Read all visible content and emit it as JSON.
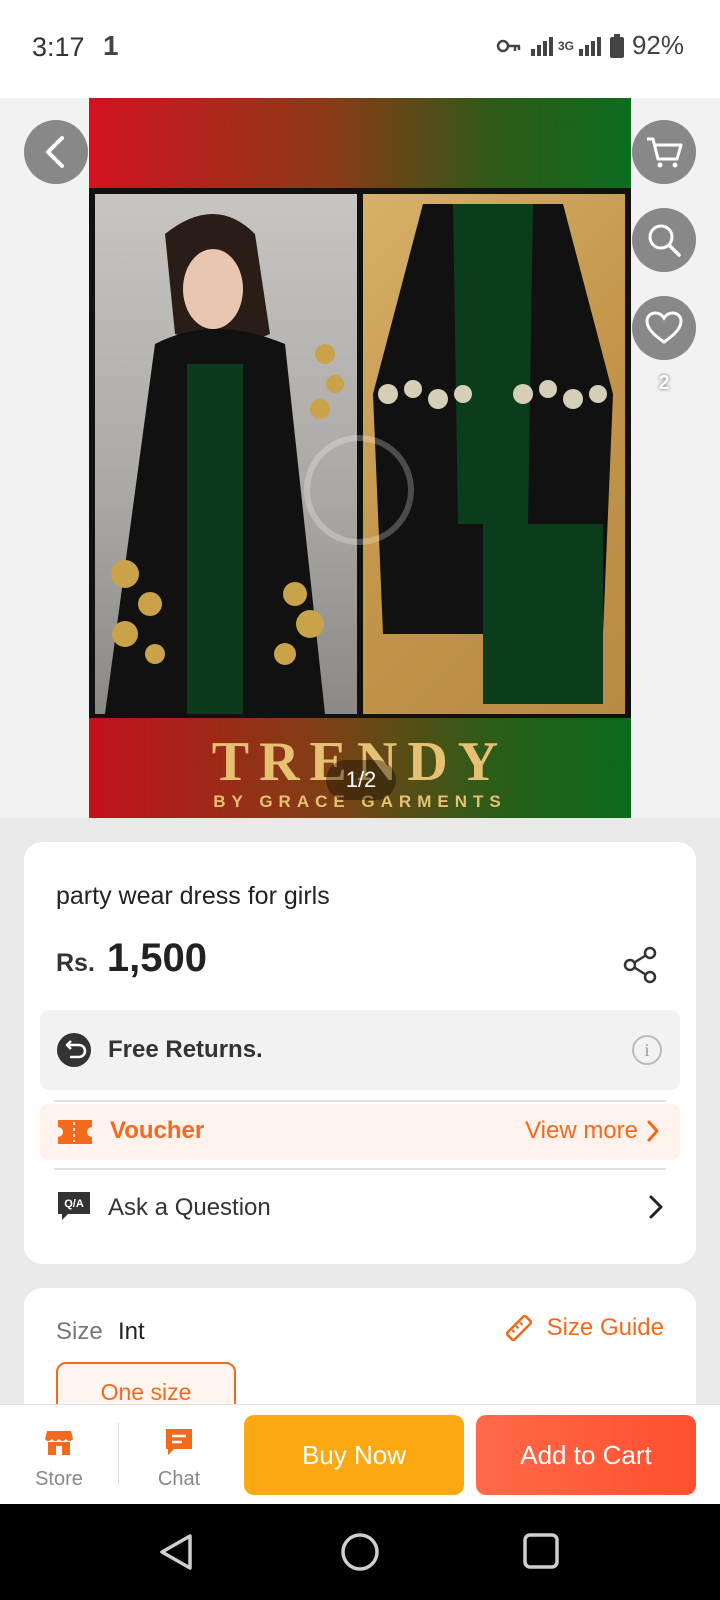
{
  "status_bar": {
    "time": "3:17",
    "notification": "1",
    "network": "3G",
    "battery": "92%"
  },
  "product_image": {
    "brand_name": "TRENDY",
    "brand_tagline": "BY GRACE GARMENTS",
    "counter": "1/2",
    "favorite_count": "2"
  },
  "product": {
    "title": "party wear dress for girls",
    "currency": "Rs.",
    "price": "1,500"
  },
  "returns": {
    "label": "Free Returns."
  },
  "voucher": {
    "label": "Voucher",
    "more_label": "View more"
  },
  "qa": {
    "badge": "Q/A",
    "label": "Ask a Question"
  },
  "size": {
    "label": "Size",
    "system": "Int",
    "guide_label": "Size Guide",
    "selected_option": "One size"
  },
  "actions": {
    "store_label": "Store",
    "chat_label": "Chat",
    "buy_now_label": "Buy Now",
    "add_to_cart_label": "Add to Cart"
  },
  "colors": {
    "accent": "#f36a1c",
    "buy_now": "#fba913",
    "add_to_cart": "#ff5a3a"
  },
  "icons": {
    "back": "chevron-left-icon",
    "cart": "cart-icon",
    "search": "search-icon",
    "favorite": "heart-icon",
    "share": "share-icon",
    "returns": "return-arrow-icon",
    "voucher": "voucher-icon",
    "size_guide": "ruler-icon",
    "store": "store-icon",
    "chat": "chat-icon"
  }
}
